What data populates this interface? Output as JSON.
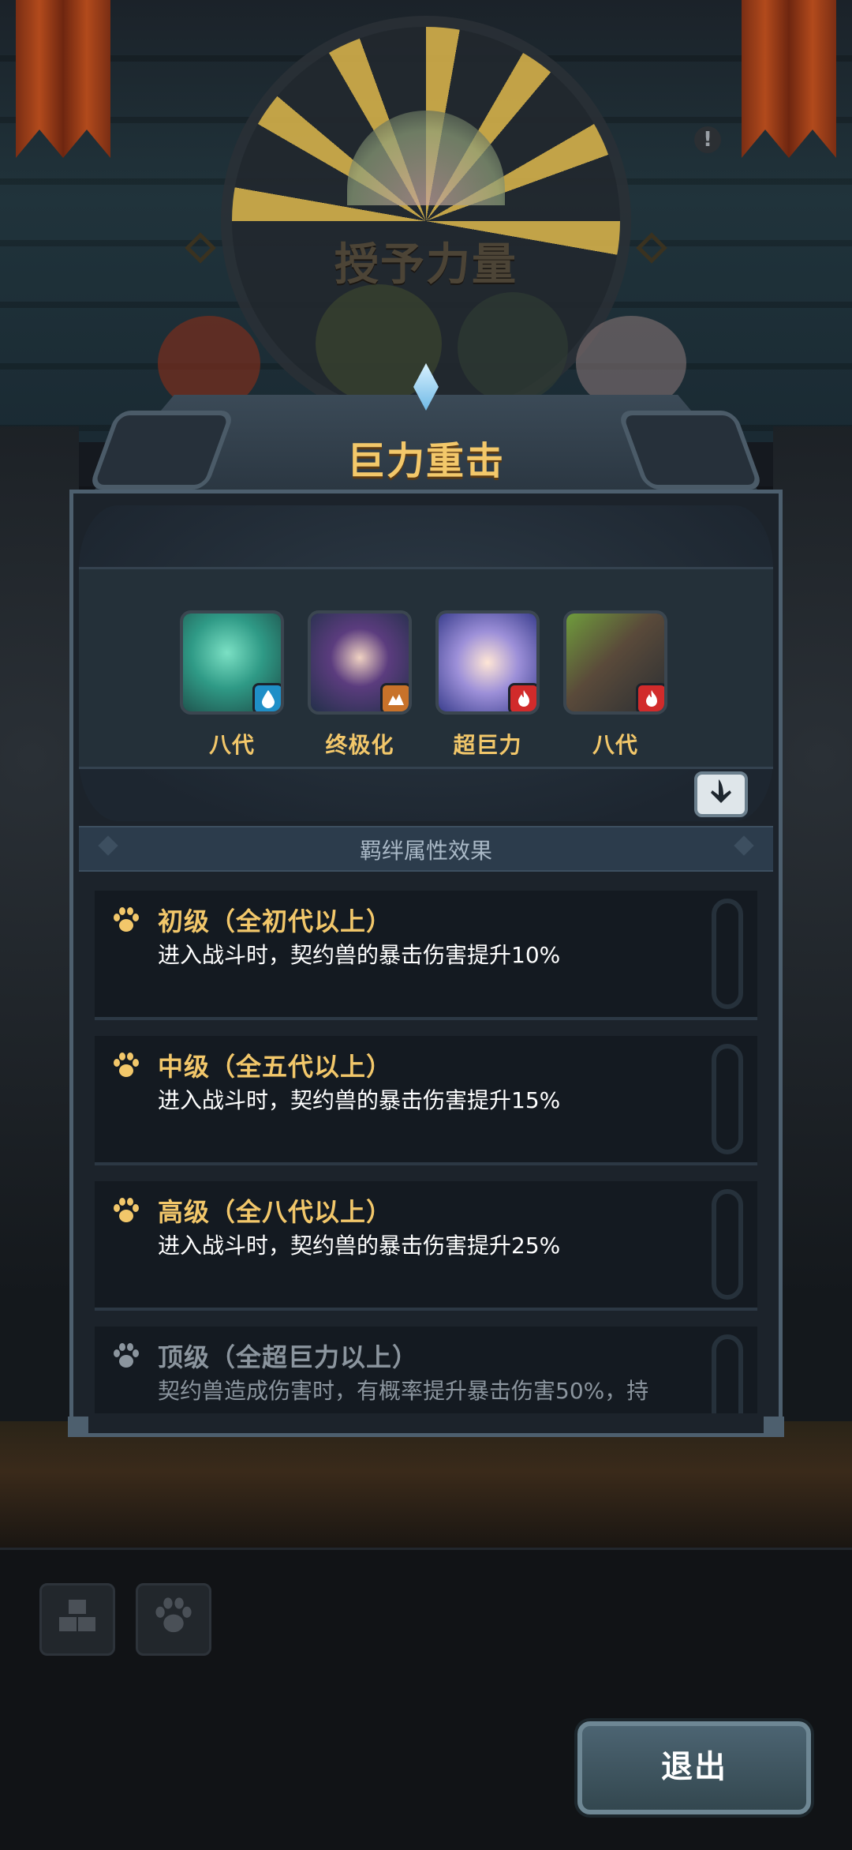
{
  "header": {
    "title": "授予力量",
    "alert_icon": "exclamation-icon"
  },
  "panel": {
    "title": "巨力重击",
    "heroes": [
      {
        "name": "八代",
        "element": "water",
        "element_icon": "water-drop-icon",
        "badge_color": "#1f8fc7"
      },
      {
        "name": "终极化",
        "element": "earth",
        "element_icon": "earth-icon",
        "badge_color": "#c8722a"
      },
      {
        "name": "超巨力",
        "element": "fire",
        "element_icon": "fire-icon",
        "badge_color": "#d12b2b"
      },
      {
        "name": "八代",
        "element": "fire",
        "element_icon": "fire-icon",
        "badge_color": "#d12b2b"
      }
    ],
    "scroll_icon": "arrow-down-icon",
    "section_label": "羁绊属性效果",
    "effects": [
      {
        "title": "初级（全初代以上）",
        "desc": "进入战斗时，契约兽的暴击伤害提升10%",
        "active": true
      },
      {
        "title": "中级（全五代以上）",
        "desc": "进入战斗时，契约兽的暴击伤害提升15%",
        "active": true
      },
      {
        "title": "高级（全八代以上）",
        "desc": "进入战斗时，契约兽的暴击伤害提升25%",
        "active": true
      },
      {
        "title": "顶级（全超巨力以上）",
        "desc": "契约兽造成伤害时，有概率提升暴击伤害50%，持",
        "active": false
      }
    ]
  },
  "toolbar": {
    "buttons": [
      {
        "icon": "blocks-icon"
      },
      {
        "icon": "paw-icon"
      }
    ]
  },
  "exit_label": "退出",
  "colors": {
    "gold": "#f2c76a",
    "panel_border": "#4d5f6e",
    "dim_text": "#8b959e"
  }
}
